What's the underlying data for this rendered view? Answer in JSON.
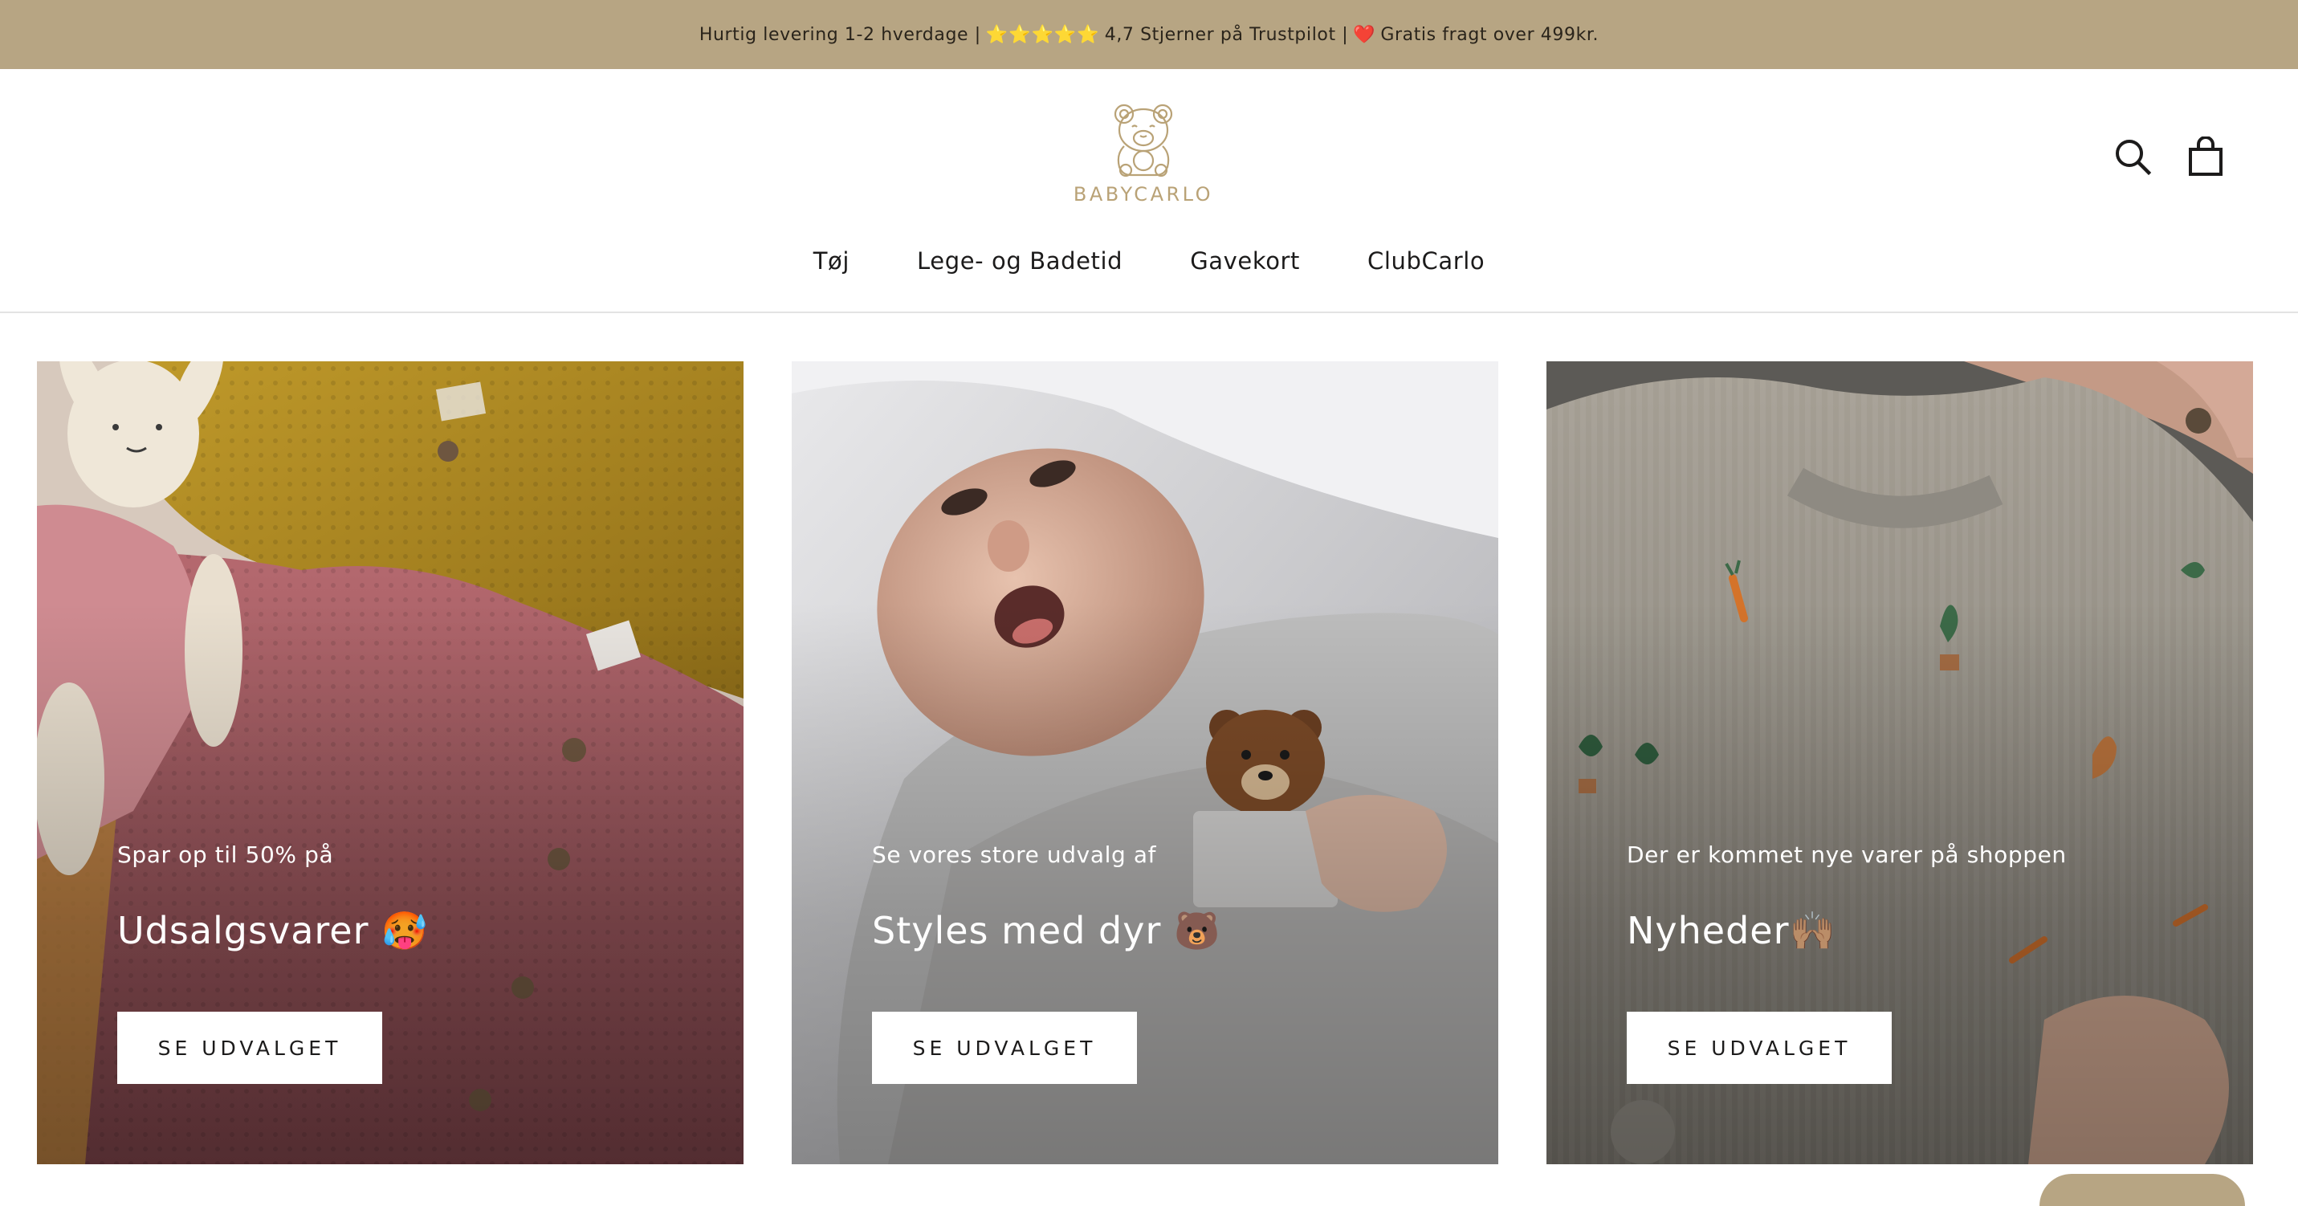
{
  "announcement": {
    "part1": "Hurtig levering 1-2 hverdage |",
    "stars": "⭐⭐⭐⭐⭐",
    "part2": "4,7 Stjerner på Trustpilot |",
    "heart": "❤️",
    "part3": "Gratis fragt over 499kr."
  },
  "header": {
    "logo_text": "BABYCARLO",
    "icons": {
      "search": "search-icon",
      "cart": "shopping-bag-icon"
    }
  },
  "nav": [
    {
      "label": "Tøj"
    },
    {
      "label": "Lege- og Badetid"
    },
    {
      "label": "Gavekort"
    },
    {
      "label": "ClubCarlo"
    }
  ],
  "cards": [
    {
      "subtitle": "Spar op til 50% på",
      "title": "Udsalgsvarer 🥵",
      "button": "SE UDVALGET"
    },
    {
      "subtitle": "Se vores store udvalg af",
      "title": "Styles med dyr 🐻",
      "button": "SE UDVALGET"
    },
    {
      "subtitle": "Der er kommet nye varer på shoppen",
      "title": "Nyheder🙌🏽",
      "button": "SE UDVALGET"
    }
  ],
  "colors": {
    "announcement_bg": "#b7a583",
    "logo": "#b9a276",
    "text": "#1c1b1b"
  }
}
